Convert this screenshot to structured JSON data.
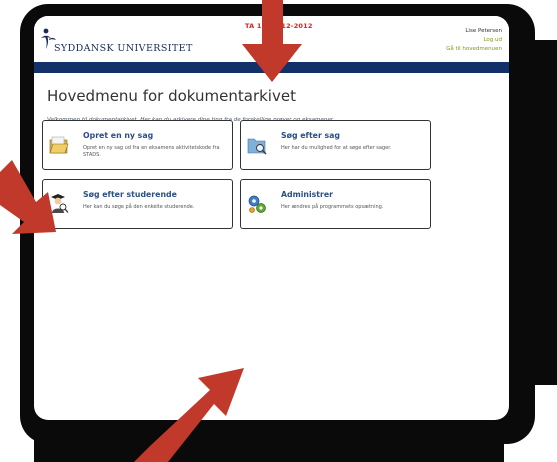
{
  "header": {
    "logo_text": "SYDDANSK UNIVERSITET",
    "env_text": "TA 1,4.  4/12-2012",
    "user_name": "Lise Petersen",
    "logout_label": "Log ud",
    "main_menu_label": "Gå til hovedmenuen"
  },
  "main": {
    "title": "Hovedmenu for dokumentarkivet",
    "welcome": "Velkommen til dokumentarkivet. Her kan du arkivere dine ting fra de forskellige prøver og eksamener."
  },
  "cards": [
    {
      "title": "Opret en ny sag",
      "desc": "Opret en ny sag ud fra en eksamens aktivitetskode fra STADS.",
      "icon": "open-folder-icon"
    },
    {
      "title": "Søg efter sag",
      "desc": "Her har du mulighed for at søge efter sager.",
      "icon": "folder-search-icon"
    },
    {
      "title": "Søg efter studerende",
      "desc": "Her kan du søge på den enkelte studerende.",
      "icon": "student-search-icon"
    },
    {
      "title": "Administrer",
      "desc": "Her ændres på programmets opsætning.",
      "icon": "gears-icon"
    }
  ],
  "colors": {
    "accent_bar": "#143069",
    "link_green": "#7a9a18",
    "env_red": "#d22222",
    "card_title_blue": "#2a4f86",
    "annotation_arrow": "#c0392b"
  },
  "annotations": [
    "arrow-top",
    "arrow-left",
    "arrow-bottom"
  ]
}
